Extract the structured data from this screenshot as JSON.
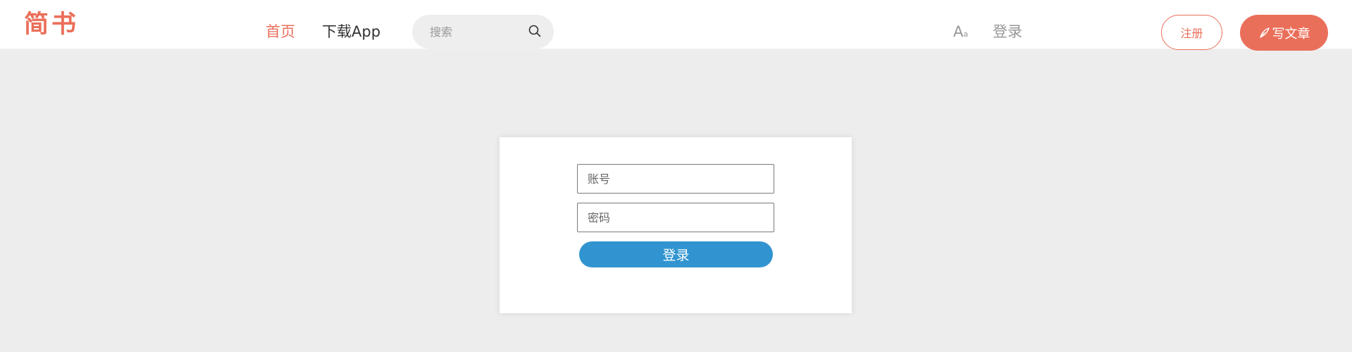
{
  "header": {
    "logo": "简书",
    "nav": {
      "home": "首页",
      "download_app": "下载App"
    },
    "search": {
      "placeholder": "搜索"
    },
    "font_toggle": {
      "big": "A",
      "small": "a"
    },
    "login": "登录",
    "register": "注册",
    "write": "写文章"
  },
  "login_form": {
    "account_placeholder": "账号",
    "password_placeholder": "密码",
    "submit": "登录"
  },
  "colors": {
    "brand": "#ea6f5a",
    "primary_button": "#3194d0",
    "background": "#ededed"
  },
  "icons": {
    "search": "search-icon",
    "font_size": "font-size-icon",
    "pen": "pen-icon"
  }
}
